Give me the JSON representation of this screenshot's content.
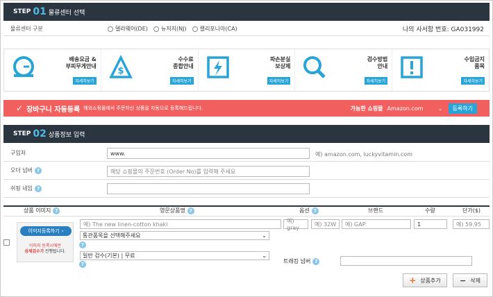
{
  "step1": {
    "step": "STEP",
    "num": "01",
    "title": "물류센터 선택"
  },
  "center": {
    "label": "물류센터 구분",
    "options": [
      "델라웨어(DE)",
      "뉴저지(NJ)",
      "캘리포니아(CA)"
    ],
    "mailbox_label": "나의 사서함 번호:",
    "mailbox_no": "GA031992"
  },
  "info": [
    {
      "title1": "배송요금 &",
      "title2": "부피무게안내",
      "btn": "자세히보기",
      "icon": "scale-icon"
    },
    {
      "title1": "수수료",
      "title2": "종합안내",
      "btn": "자세히보기",
      "icon": "dollar-icon"
    },
    {
      "title1": "파손분실",
      "title2": "보상제",
      "btn": "자세히보기",
      "icon": "broken-icon"
    },
    {
      "title1": "검수방법",
      "title2": "안내",
      "btn": "자세히보기",
      "icon": "magnifier-icon"
    },
    {
      "title1": "수입금지",
      "title2": "품목",
      "btn": "자세히보기",
      "icon": "warning-icon"
    }
  ],
  "cart": {
    "check": "✓",
    "title": "장바구니 자동등록",
    "desc": "해외쇼핑몰에서 주문하신 상품을 자동으로 등록해드립니다.",
    "mall_label": "가능한 쇼핑몰",
    "mall_value": "Amazon.com",
    "btn": "등록하기"
  },
  "step2": {
    "step": "STEP",
    "num": "02",
    "title": "상품정보 입력"
  },
  "form": {
    "store_label": "구입처",
    "store_value": "www.",
    "store_example": "예) amazon.com, luckyvitamin.com",
    "order_label": "오더 넘버",
    "order_placeholder": "해당 쇼핑몰의 주문번호 (Order No)를 입력해 주세요",
    "ship_label": "쉬핑 네임"
  },
  "table": {
    "headers": {
      "image": "상품 이미지",
      "name": "영문상품명",
      "option": "옵션",
      "brand": "브랜드",
      "qty": "수량",
      "price": "단가($)"
    },
    "img_btn": "이미지등록하기",
    "img_note1": "이미지 등록시에만",
    "img_note2a": "상세검수가",
    "img_note2b": " 진행됩니다.",
    "name_ph": "예) The new linen-cotton khaki",
    "opt1_ph": "예) gray",
    "opt2_ph": "예) 32W",
    "brand_ph": "예) GAP",
    "qty": "1",
    "price_ph": "예) 59.95",
    "customs_select": "통관품목을 선택해주세요",
    "inspect_select": "일반 검수(기본) | 무료",
    "tracking_label": "트래킹 넘버"
  },
  "actions": {
    "add": "상품추가",
    "delete": "삭제"
  },
  "colors": {
    "header_bg": "#2b3540",
    "accent": "#4fb9e6",
    "cart_bg": "#f25f5f",
    "btn_blue": "#27a4d8"
  }
}
